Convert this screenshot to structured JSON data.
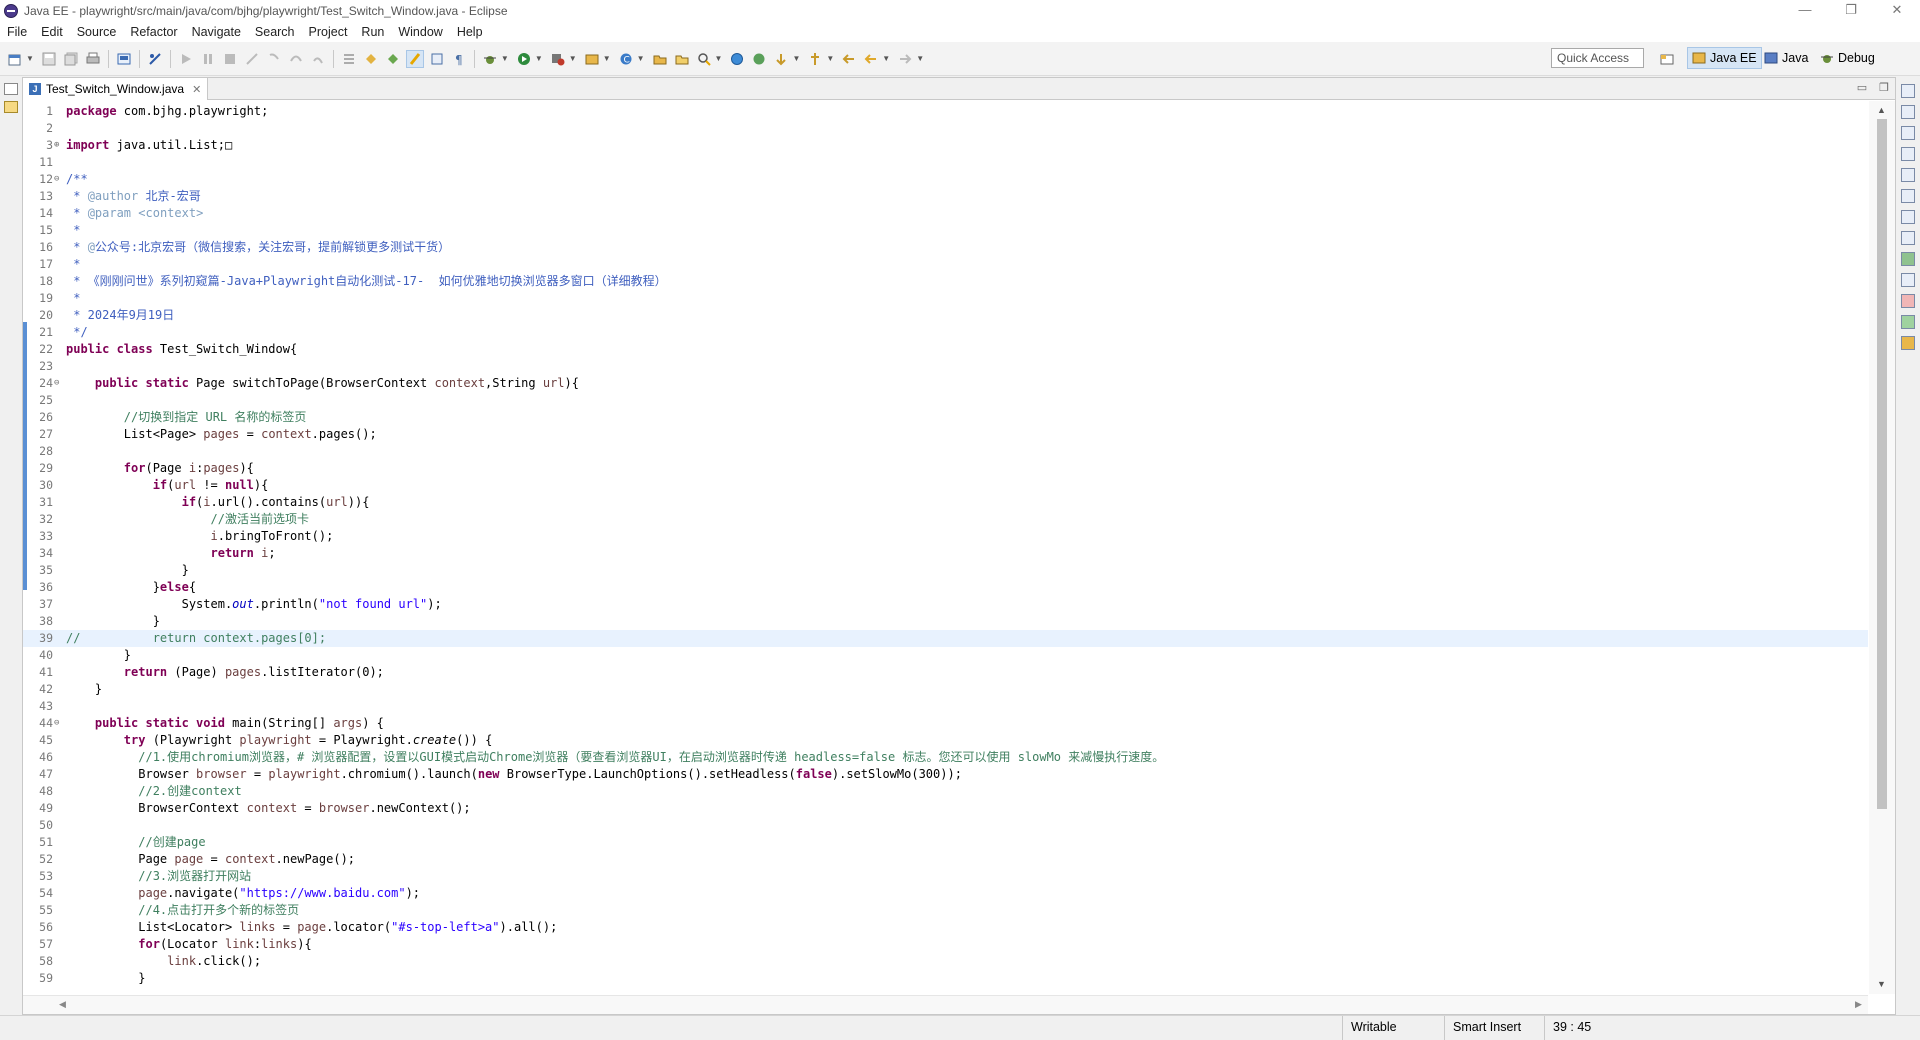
{
  "window": {
    "title": "Java EE - playwright/src/main/java/com/bjhg/playwright/Test_Switch_Window.java - Eclipse",
    "controls": [
      "—",
      "❐",
      "✕"
    ]
  },
  "menu": [
    "File",
    "Edit",
    "Source",
    "Refactor",
    "Navigate",
    "Search",
    "Project",
    "Run",
    "Window",
    "Help"
  ],
  "toolbar": {
    "quick_access": "Quick Access",
    "perspectives": [
      {
        "label": "Java EE",
        "active": true
      },
      {
        "label": "Java",
        "active": false
      },
      {
        "label": "Debug",
        "active": false
      }
    ]
  },
  "editor": {
    "tab_title": "Test_Switch_Window.java",
    "tab_icon": "java-file-icon",
    "lines": [
      {
        "n": "1",
        "fold": "",
        "html": "<span class='kw'>package</span> com.bjhg.playwright;"
      },
      {
        "n": "2",
        "fold": "",
        "html": ""
      },
      {
        "n": "3",
        "fold": "⊕",
        "html": "<span class='kw'>import</span> java.util.List;□"
      },
      {
        "n": "11",
        "fold": "",
        "html": ""
      },
      {
        "n": "12",
        "fold": "⊖",
        "html": "<span class='doc'>/**</span>"
      },
      {
        "n": "13",
        "fold": "",
        "html": "<span class='doc'> * <span class='tag'>@author</span> 北京-宏哥</span>"
      },
      {
        "n": "14",
        "fold": "",
        "html": "<span class='doc'> * <span class='tag'>@param</span> <span class='tag'>&lt;context&gt;</span></span>"
      },
      {
        "n": "15",
        "fold": "",
        "html": "<span class='doc'> *</span>"
      },
      {
        "n": "16",
        "fold": "",
        "html": "<span class='doc'> * <span class='tag'>@</span>公众号:北京宏哥（微信搜索，关注宏哥，提前解锁更多测试干货）</span>"
      },
      {
        "n": "17",
        "fold": "",
        "html": "<span class='doc'> *</span>"
      },
      {
        "n": "18",
        "fold": "",
        "html": "<span class='doc'> * 《刚刚问世》系列初窥篇-Java+Playwright自动化测试-17-  如何优雅地切换浏览器多窗口（详细教程）</span>"
      },
      {
        "n": "19",
        "fold": "",
        "html": "<span class='doc'> *</span>"
      },
      {
        "n": "20",
        "fold": "",
        "html": "<span class='doc'> * 2024年9月19日</span>"
      },
      {
        "n": "21",
        "fold": "",
        "html": "<span class='doc'> */</span>"
      },
      {
        "n": "22",
        "fold": "",
        "html": "<span class='kw'>public class</span> Test_Switch_Window{"
      },
      {
        "n": "23",
        "fold": "",
        "html": ""
      },
      {
        "n": "24",
        "fold": "⊖",
        "html": "    <span class='kw'>public static</span> Page switchToPage(BrowserContext <span class='var'>context</span>,String <span class='var'>url</span>){"
      },
      {
        "n": "25",
        "fold": "",
        "html": ""
      },
      {
        "n": "26",
        "fold": "",
        "html": "        <span class='cm'>//切换到指定 URL 名称的标签页</span>"
      },
      {
        "n": "27",
        "fold": "",
        "html": "        List&lt;Page&gt; <span class='var'>pages</span> = <span class='var'>context</span>.pages();"
      },
      {
        "n": "28",
        "fold": "",
        "html": ""
      },
      {
        "n": "29",
        "fold": "",
        "html": "        <span class='kw'>for</span>(Page <span class='var'>i</span>:<span class='var'>pages</span>){"
      },
      {
        "n": "30",
        "fold": "",
        "html": "            <span class='kw'>if</span>(<span class='var'>url</span> != <span class='kw'>null</span>){"
      },
      {
        "n": "31",
        "fold": "",
        "html": "                <span class='kw'>if</span>(<span class='var'>i</span>.url().contains(<span class='var'>url</span>)){"
      },
      {
        "n": "32",
        "fold": "",
        "html": "                    <span class='cm'>//激活当前选项卡</span>"
      },
      {
        "n": "33",
        "fold": "",
        "html": "                    <span class='var'>i</span>.bringToFront();"
      },
      {
        "n": "34",
        "fold": "",
        "html": "                    <span class='kw'>return</span> <span class='var'>i</span>;"
      },
      {
        "n": "35",
        "fold": "",
        "html": "                }"
      },
      {
        "n": "36",
        "fold": "",
        "html": "            }<span class='kw'>else</span>{"
      },
      {
        "n": "37",
        "fold": "",
        "html": "                System.<span class='fld'><i>out</i></span>.println(<span class='str'>\"not found url\"</span>);"
      },
      {
        "n": "38",
        "fold": "",
        "html": "            }"
      },
      {
        "n": "39",
        "fold": "",
        "html": "<span class='cm'>//          return context.pages[0];</span>",
        "hl": true
      },
      {
        "n": "40",
        "fold": "",
        "html": "        }"
      },
      {
        "n": "41",
        "fold": "",
        "html": "        <span class='kw'>return</span> (Page) <span class='var'>pages</span>.listIterator(0);"
      },
      {
        "n": "42",
        "fold": "",
        "html": "    }"
      },
      {
        "n": "43",
        "fold": "",
        "html": ""
      },
      {
        "n": "44",
        "fold": "⊖",
        "html": "    <span class='kw'>public static void</span> main(String[] <span class='var'>args</span>) {"
      },
      {
        "n": "45",
        "fold": "",
        "html": "        <span class='kw'>try</span> (Playwright <span class='var'>playwright</span> = Playwright.<i>create</i>()) {"
      },
      {
        "n": "46",
        "fold": "",
        "html": "          <span class='cm'>//1.使用chromium浏览器，# 浏览器配置，设置以GUI模式启动Chrome浏览器（要查看浏览器UI，在启动浏览器时传递 headless=false 标志。您还可以使用 slowMo 来减慢执行速度。</span>"
      },
      {
        "n": "47",
        "fold": "",
        "html": "          Browser <span class='var'>browser</span> = <span class='var'>playwright</span>.chromium().launch(<span class='kw'>new</span> BrowserType.LaunchOptions().setHeadless(<span class='kw'>false</span>).setSlowMo(300));"
      },
      {
        "n": "48",
        "fold": "",
        "html": "          <span class='cm'>//2.创建context</span>"
      },
      {
        "n": "49",
        "fold": "",
        "html": "          BrowserContext <span class='var'>context</span> = <span class='var'>browser</span>.newContext();"
      },
      {
        "n": "50",
        "fold": "",
        "html": ""
      },
      {
        "n": "51",
        "fold": "",
        "html": "          <span class='cm'>//创建page</span>"
      },
      {
        "n": "52",
        "fold": "",
        "html": "          Page <span class='var'>page</span> = <span class='var'>context</span>.newPage();"
      },
      {
        "n": "53",
        "fold": "",
        "html": "          <span class='cm'>//3.浏览器打开网站</span>"
      },
      {
        "n": "54",
        "fold": "",
        "html": "          <span class='var'>page</span>.navigate(<span class='str'>\"https://www.baidu.com\"</span>);"
      },
      {
        "n": "55",
        "fold": "",
        "html": "          <span class='cm'>//4.点击打开多个新的标签页</span>"
      },
      {
        "n": "56",
        "fold": "",
        "html": "          List&lt;Locator&gt; <span class='var'>links</span> = <span class='var'>page</span>.locator(<span class='str'>\"#s-top-left&gt;a\"</span>).all();"
      },
      {
        "n": "57",
        "fold": "",
        "html": "          <span class='kw'>for</span>(Locator <span class='var'>link</span>:<span class='var'>links</span>){"
      },
      {
        "n": "58",
        "fold": "",
        "html": "              <span class='var'>link</span>.click();"
      },
      {
        "n": "59",
        "fold": "",
        "html": "          }"
      }
    ]
  },
  "status": {
    "writable": "Writable",
    "insert_mode": "Smart Insert",
    "position": "39 : 45"
  }
}
